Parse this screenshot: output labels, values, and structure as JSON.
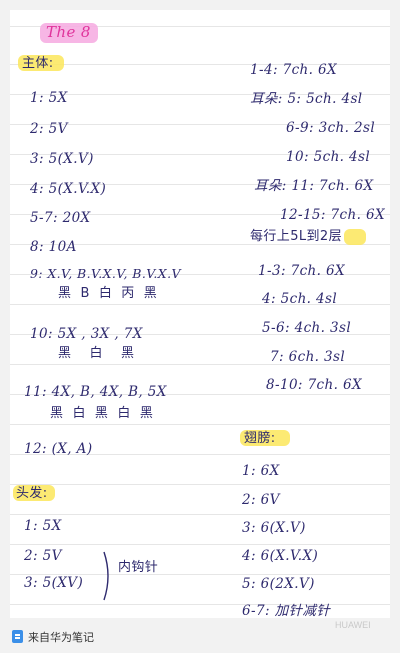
{
  "title": "The 8",
  "left": {
    "section1_heading": "主体:",
    "rows": [
      "1: 5X",
      "2: 5V",
      "3: 5(X.V)",
      "4: 5(X.V.X)",
      "5-7: 20X",
      "8: 10A",
      "9: X.V, B.V.X.V, B.V.X.V",
      "黑  B  白  丙  黑",
      "10: 5X , 3X , 7X",
      "黑    白    黑",
      "11: 4X, B, 4X, B, 5X",
      "黑  白  黑  白  黑",
      "12: (X, A)"
    ],
    "section2_heading": "头发:",
    "hair_rows": [
      "1: 5X",
      "2: 5V",
      "3: 5(XV)"
    ],
    "hair_note": "内钩针"
  },
  "right": {
    "rows": [
      "1-4: 7ch. 6X",
      "耳朵: 5: 5ch. 4sl",
      "6-9: 3ch. 2sl",
      "10: 5ch. 4sl",
      "耳朵: 11: 7ch. 6X",
      "12-15: 7ch. 6X",
      "每行上5L到2层",
      "1-3: 7ch. 6X",
      "4: 5ch. 4sl",
      "5-6: 4ch. 3sl",
      "7: 6ch. 3sl",
      "8-10: 7ch. 6X"
    ],
    "section_heading": "翅膀:",
    "wing_rows": [
      "1: 6X",
      "2: 6V",
      "3: 6(X.V)",
      "4: 6(X.V.X)",
      "5: 6(2X.V)",
      "6-7: 加针减针"
    ]
  },
  "footer": {
    "source": "来自华为笔记",
    "watermark": "HUAWEI"
  },
  "colors": {
    "ink": "#2e2a6e",
    "highlight_pink": "#f5a3de",
    "highlight_yellow": "#fbe65a",
    "title_ink": "#e0349c"
  }
}
